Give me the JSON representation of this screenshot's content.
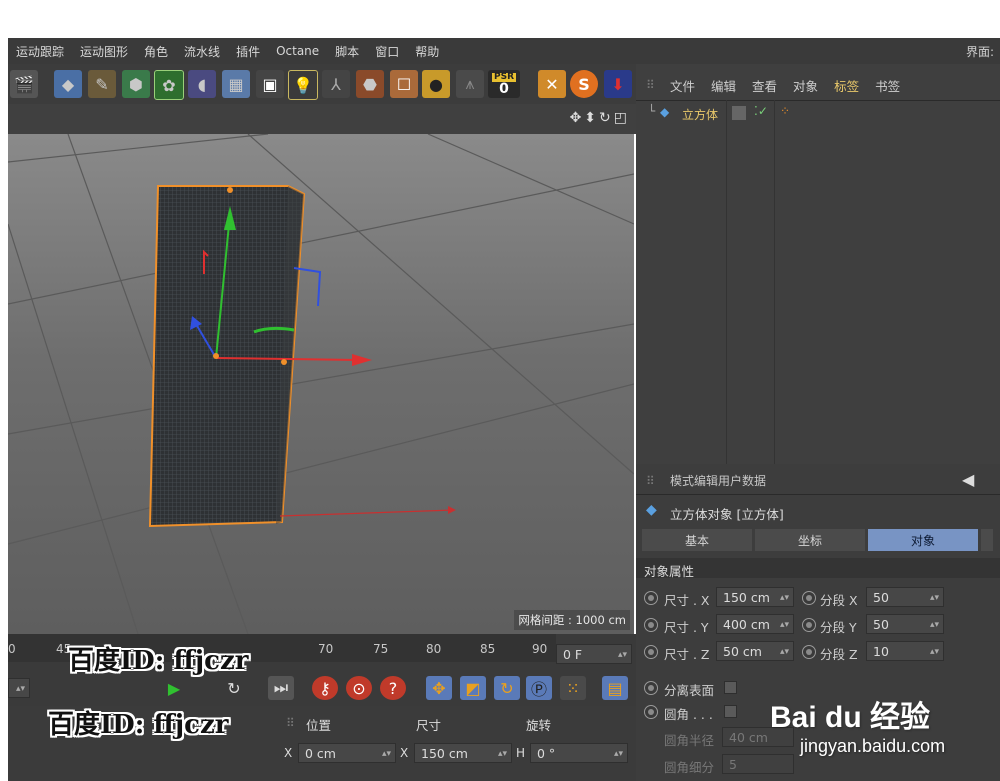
{
  "menubar": {
    "items": [
      "运动跟踪",
      "运动图形",
      "角色",
      "流水线",
      "插件",
      "Octane",
      "脚本",
      "窗口",
      "帮助"
    ],
    "right_label": "界面:"
  },
  "toolbar": {
    "psr_label": "PSR",
    "psr_value": "0"
  },
  "object_manager": {
    "menu": [
      "文件",
      "编辑",
      "查看",
      "对象",
      "标签",
      "书签"
    ],
    "active_menu": "标签",
    "objects": [
      {
        "name": "立方体"
      }
    ]
  },
  "viewport": {
    "grid_info": "网格间距 : 1000 cm"
  },
  "attributes": {
    "menu": [
      "模式",
      "编辑",
      "用户数据"
    ],
    "title": "立方体对象 [立方体]",
    "tabs": [
      "基本",
      "坐标",
      "对象"
    ],
    "active_tab": "对象",
    "section_title": "对象属性",
    "rows": [
      {
        "label": "尺寸 . X",
        "value": "150 cm",
        "seg_label": "分段 X",
        "seg_value": "50"
      },
      {
        "label": "尺寸 . Y",
        "value": "400 cm",
        "seg_label": "分段 Y",
        "seg_value": "50"
      },
      {
        "label": "尺寸 . Z",
        "value": "50 cm",
        "seg_label": "分段 Z",
        "seg_value": "10"
      }
    ],
    "separate_surfaces": "分离表面",
    "fillet": "圆角 . . .",
    "fillet_radius_label": "圆角半径",
    "fillet_radius_value": "40 cm",
    "fillet_sub_label": "圆角细分",
    "fillet_sub_value": "5"
  },
  "timeline": {
    "ticks": [
      "0",
      "45",
      "70",
      "75",
      "80",
      "85",
      "90"
    ],
    "frame_field": "0 F"
  },
  "coordinates": {
    "headers": [
      "位置",
      "尺寸",
      "旋转"
    ],
    "x_label": "X",
    "pos_x": "0 cm",
    "size_label": "X",
    "size_x": "150 cm",
    "rot_label": "H",
    "rot_h": "0 °"
  },
  "watermark": {
    "id_text": "百度ID: ffjczr",
    "baidu_logo": "Bai du 经验",
    "baidu_url": "jingyan.baidu.com"
  },
  "colors": {
    "selected_object": "#e8c86a",
    "active_tab": "#7894c4",
    "x_axis": "#e03030",
    "y_axis": "#30c030",
    "z_axis": "#3050e0",
    "selection_outline": "#f0902a"
  }
}
